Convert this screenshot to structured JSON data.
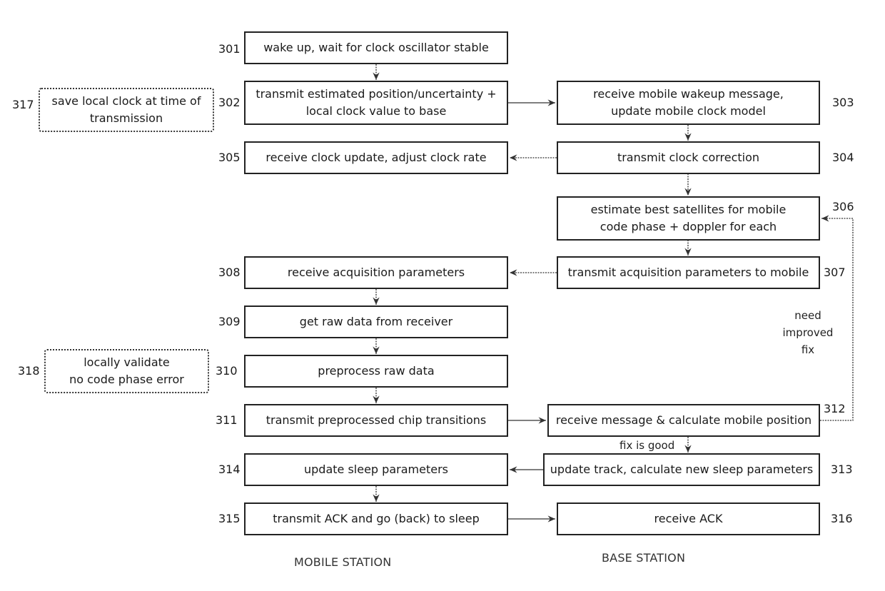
{
  "diagram": {
    "columns": {
      "mobile": "MOBILE STATION",
      "base": "BASE STATION"
    },
    "steps": [
      {
        "id": "301",
        "text": "wake up, wait for clock oscillator stable"
      },
      {
        "id": "302",
        "text": "transmit estimated position/uncertainty +\nlocal clock value to base"
      },
      {
        "id": "303",
        "text": "receive mobile wakeup message,\nupdate mobile clock model"
      },
      {
        "id": "304",
        "text": "transmit clock correction"
      },
      {
        "id": "305",
        "text": "receive clock update, adjust clock rate"
      },
      {
        "id": "306",
        "text": "estimate best satellites for mobile\ncode phase + doppler for each"
      },
      {
        "id": "307",
        "text": "transmit acquisition parameters to mobile"
      },
      {
        "id": "308",
        "text": "receive acquisition parameters"
      },
      {
        "id": "309",
        "text": "get raw data from receiver"
      },
      {
        "id": "310",
        "text": "preprocess raw data"
      },
      {
        "id": "311",
        "text": "transmit preprocessed chip transitions"
      },
      {
        "id": "312",
        "text": "receive message & calculate mobile position"
      },
      {
        "id": "313",
        "text": "update track, calculate new sleep parameters"
      },
      {
        "id": "314",
        "text": "update sleep parameters"
      },
      {
        "id": "315",
        "text": "transmit ACK and go (back) to sleep"
      },
      {
        "id": "316",
        "text": "receive ACK"
      },
      {
        "id": "317",
        "text": "save local clock at time of\ntransmission"
      },
      {
        "id": "318",
        "text": "locally validate\nno code phase error"
      }
    ],
    "edge_labels": {
      "need_improved_fix": "need\nimproved\nfix",
      "fix_is_good": "fix is good"
    },
    "edges": [
      {
        "from": "301",
        "to": "302"
      },
      {
        "from": "302",
        "to": "303"
      },
      {
        "from": "303",
        "to": "304"
      },
      {
        "from": "304",
        "to": "305"
      },
      {
        "from": "304",
        "to": "306"
      },
      {
        "from": "306",
        "to": "307"
      },
      {
        "from": "307",
        "to": "308"
      },
      {
        "from": "308",
        "to": "309"
      },
      {
        "from": "309",
        "to": "310"
      },
      {
        "from": "310",
        "to": "311"
      },
      {
        "from": "311",
        "to": "312"
      },
      {
        "from": "312",
        "to": "306",
        "label": "need improved fix"
      },
      {
        "from": "312",
        "to": "313",
        "label": "fix is good"
      },
      {
        "from": "313",
        "to": "314"
      },
      {
        "from": "314",
        "to": "315"
      },
      {
        "from": "315",
        "to": "316"
      }
    ]
  }
}
